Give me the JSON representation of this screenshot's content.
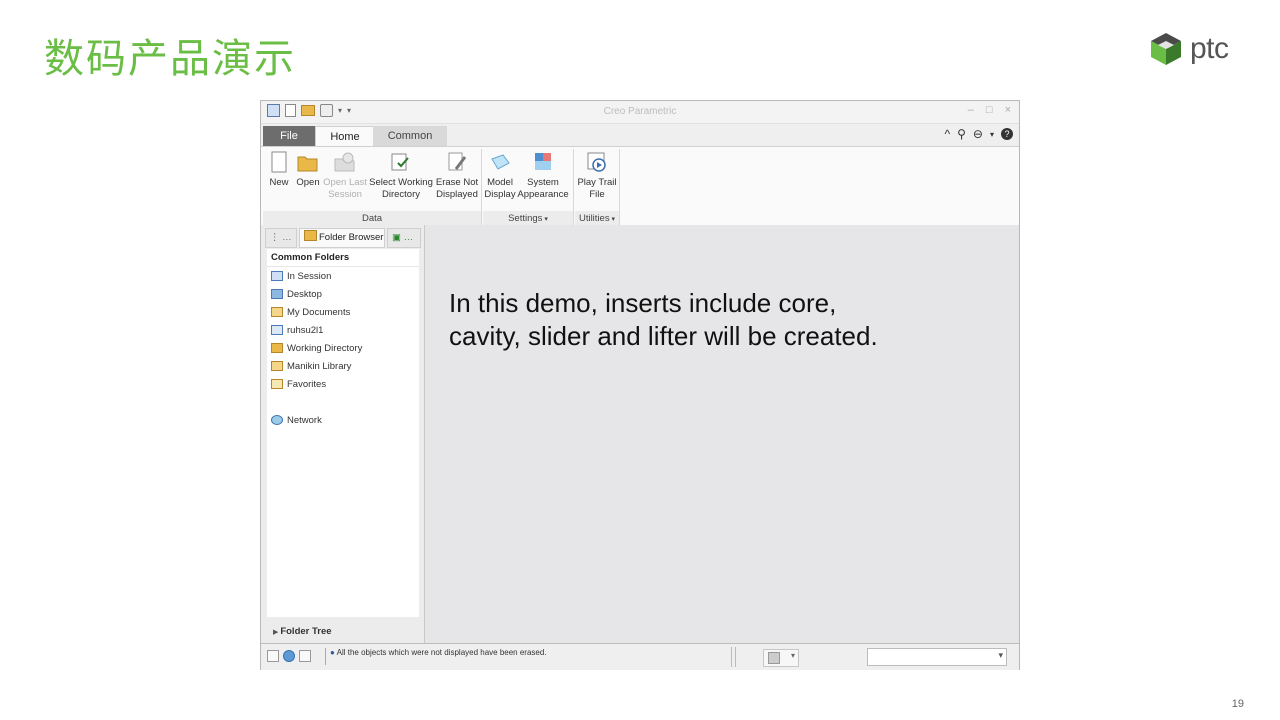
{
  "slide": {
    "title": "数码产品演示",
    "logo_text": "ptc",
    "page_number": "19",
    "brand_color": "#6abd45"
  },
  "app": {
    "window_title": "Creo Parametric",
    "tabs": [
      "File",
      "Home",
      "Common"
    ],
    "ribbon": {
      "groups": [
        {
          "label": "Data",
          "buttons": [
            {
              "label": "New",
              "icon": "new-file-icon"
            },
            {
              "label": "Open",
              "icon": "open-folder-icon"
            },
            {
              "label": "Open Last Session",
              "icon": "open-last-session-icon",
              "disabled": true
            },
            {
              "label": "Select Working Directory",
              "icon": "working-directory-icon"
            },
            {
              "label": "Erase Not Displayed",
              "icon": "erase-icon"
            }
          ]
        },
        {
          "label": "Settings",
          "buttons": [
            {
              "label": "Model Display",
              "icon": "model-display-icon"
            },
            {
              "label": "System Appearance",
              "icon": "system-appearance-icon"
            }
          ]
        },
        {
          "label": "Utilities",
          "buttons": [
            {
              "label": "Play Trail File",
              "icon": "trail-file-icon"
            }
          ]
        }
      ]
    },
    "panel": {
      "tabs": [
        "Folder Browser"
      ],
      "section_title": "Common Folders",
      "folders": [
        "In Session",
        "Desktop",
        "My Documents",
        "ruhsu2l1",
        "Working Directory",
        "Manikin Library",
        "Favorites",
        "Network"
      ],
      "folder_tree_label": "Folder Tree"
    },
    "overlay_text": {
      "line1": "In this demo, inserts include core,",
      "line2": "cavity, slider and lifter will be created."
    },
    "status": {
      "message": "All the objects which were not displayed have been erased."
    }
  }
}
